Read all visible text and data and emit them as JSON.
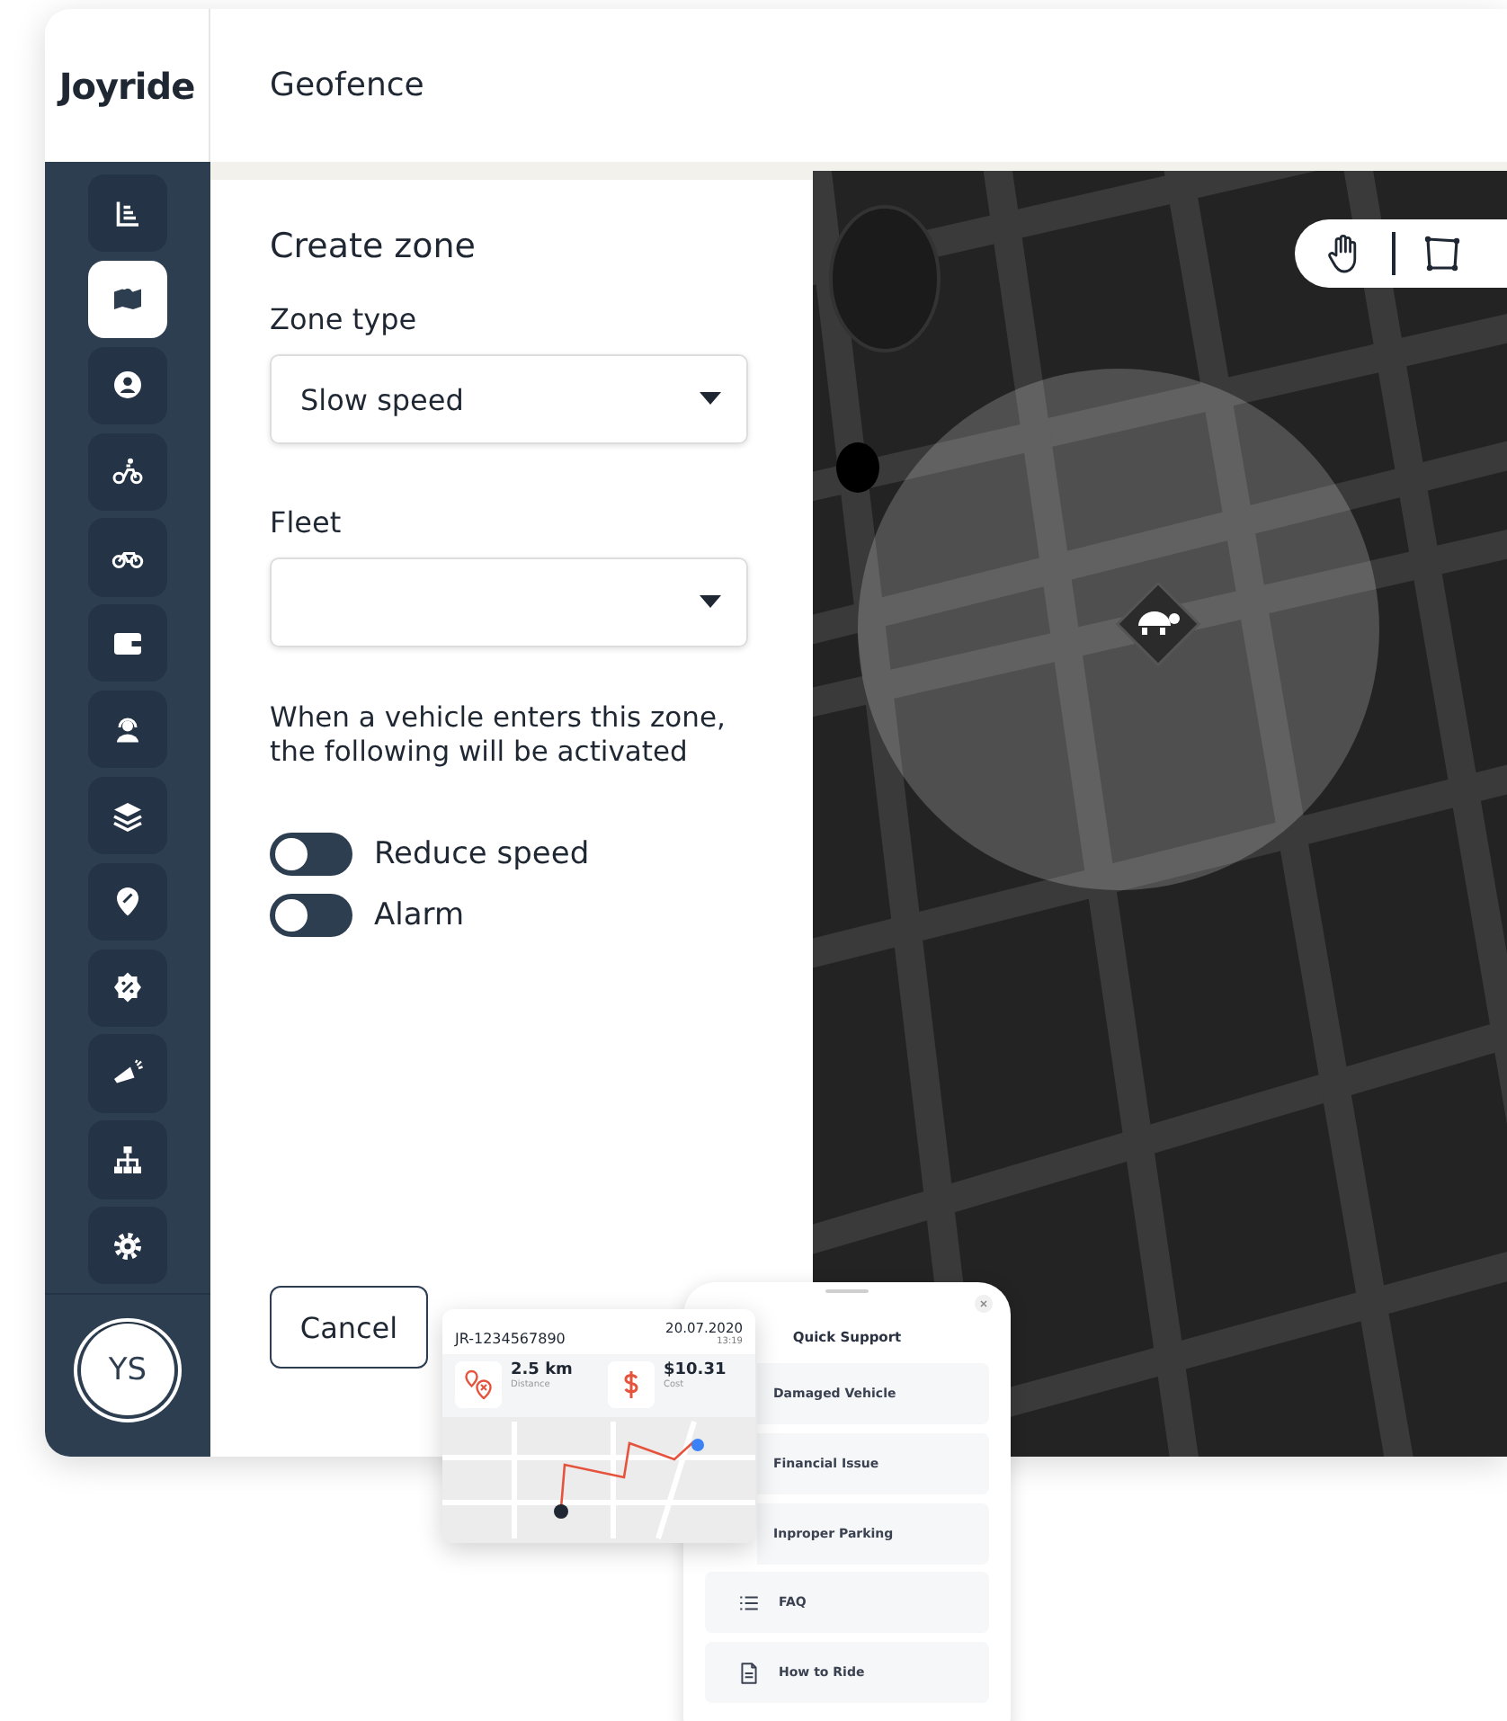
{
  "brand": {
    "logo": "Joyride"
  },
  "header": {
    "title": "Geofence"
  },
  "sidebar": {
    "items": [
      {
        "kind": "chart",
        "selected": false
      },
      {
        "kind": "map",
        "selected": true
      },
      {
        "kind": "user",
        "selected": false
      },
      {
        "kind": "scooter",
        "selected": false
      },
      {
        "kind": "bike",
        "selected": false
      },
      {
        "kind": "wallet",
        "selected": false
      },
      {
        "kind": "support",
        "selected": false
      },
      {
        "kind": "layers",
        "selected": false
      },
      {
        "kind": "pin",
        "selected": false
      },
      {
        "kind": "discount",
        "selected": false
      },
      {
        "kind": "megaphone",
        "selected": false
      },
      {
        "kind": "hierarchy",
        "selected": false
      },
      {
        "kind": "settings",
        "selected": false
      }
    ],
    "avatar": "YS"
  },
  "form": {
    "title": "Create zone",
    "fields": [
      {
        "label": "Zone type",
        "value": "Slow speed"
      },
      {
        "label": "Fleet"
      }
    ],
    "description": "When a vehicle enters this zone, the following will be activated",
    "toggles": [
      {
        "label": "Reduce speed",
        "on": false
      },
      {
        "label": "Alarm",
        "on": false
      }
    ],
    "cancel": "Cancel"
  },
  "map": {
    "tools": [
      {
        "kind": "hand"
      },
      {
        "kind": "polygon"
      }
    ]
  },
  "ride_card": {
    "id": "JR-1234567890",
    "date": "20.07.2020",
    "time": "13:19",
    "stats": [
      {
        "kind": "distance",
        "value": "2.5 km",
        "caption": "Distance"
      },
      {
        "kind": "cost",
        "value": "$10.31",
        "caption": "Cost"
      }
    ]
  },
  "quick_support": {
    "title": "Quick Support",
    "items": [
      {
        "kind": "plain",
        "label": "Damaged Vehicle"
      },
      {
        "kind": "plain",
        "label": "Financial Issue"
      },
      {
        "kind": "plain",
        "label": "Inproper Parking"
      },
      {
        "kind": "faq",
        "label": "FAQ"
      },
      {
        "kind": "guide",
        "label": "How to Ride"
      }
    ]
  }
}
